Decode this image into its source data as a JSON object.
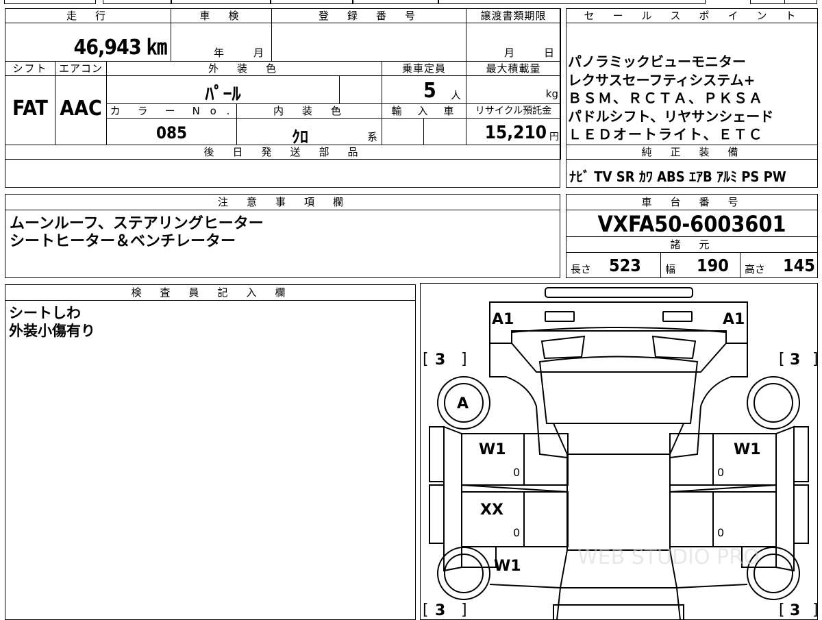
{
  "top_strip": {
    "partial_text": ""
  },
  "vehicle": {
    "mileage_label": "走　行",
    "mileage_value": "46,943 ㎞",
    "inspection_label": "車　検",
    "inspection_year_unit": "年",
    "inspection_month_unit": "月",
    "registration_label": "登　録　番　号",
    "registration_value": "",
    "transfer_label": "譲渡書類期限",
    "transfer_month_unit": "月",
    "transfer_day_unit": "日",
    "shift_label": "シフト",
    "shift_value": "FAT",
    "ac_label": "エアコン",
    "ac_value": "AAC",
    "exterior_label": "外　装　色",
    "exterior_value": "ﾊﾟｰﾙ",
    "capacity_label": "乗車定員",
    "capacity_value": "5",
    "capacity_unit": "人",
    "max_load_label": "最大積載量",
    "max_load_unit": "kg",
    "color_no_label": "カ　ラ　ー　N o .",
    "color_no_value": "085",
    "interior_label": "内　装　色",
    "interior_value": "ｸﾛ",
    "interior_suffix": "系",
    "import_label": "輸　入　車",
    "recycle_label": "リサイクル預託金",
    "recycle_value": "15,210",
    "recycle_unit": "円",
    "later_parts_label": "後　日　発　送　部　品"
  },
  "sales_points": {
    "label": "セ　ー　ル　ス　ポ　イ　ン　ト",
    "lines": [
      "パノラミックビューモニター",
      "レクサスセーフティシステム+",
      "ＢＳＭ、ＲＣＴＡ、ＰＫＳＡ",
      "パドルシフト、リヤサンシェード",
      "ＬＥＤオートライト、ＥＴＣ"
    ]
  },
  "genuine_equipment": {
    "label": "純　正　装　備",
    "items": [
      "ﾅﾋﾞ",
      "TV",
      "SR",
      "ｶﾜ",
      "ABS",
      "ｴｱB",
      "ｱﾙﾐ",
      "PS",
      "PW"
    ]
  },
  "notes": {
    "label": "注　意　事　項　欄",
    "lines": [
      "ムーンルーフ、ステアリングヒーター",
      "シートヒーター＆ベンチレーター"
    ]
  },
  "chassis": {
    "label": "車　台　番　号",
    "value": "VXFA50-6003601",
    "specs_label": "諸　元",
    "length_label": "長さ",
    "length_value": "523",
    "width_label": "幅",
    "width_value": "190",
    "height_label": "高さ",
    "height_value": "145"
  },
  "inspector": {
    "label": "検　査　員　記　入　欄",
    "lines": [
      "シートしわ",
      "外装小傷有り"
    ]
  },
  "diagram": {
    "marks": {
      "front_left": "A1",
      "front_right": "A1",
      "tire_fl": "3",
      "tire_fr": "3",
      "tire_rl": "3",
      "tire_rr": "3",
      "wheel_fl": "A",
      "door_fl": "W1",
      "door_fl_zero": "0",
      "door_fr": "W1",
      "door_fr_zero": "0",
      "door_rl": "XX",
      "door_rl_zero": "0",
      "door_rr_zero": "0",
      "quarter_rl": "W1"
    },
    "watermark": "WEB STUDIO PRO"
  }
}
